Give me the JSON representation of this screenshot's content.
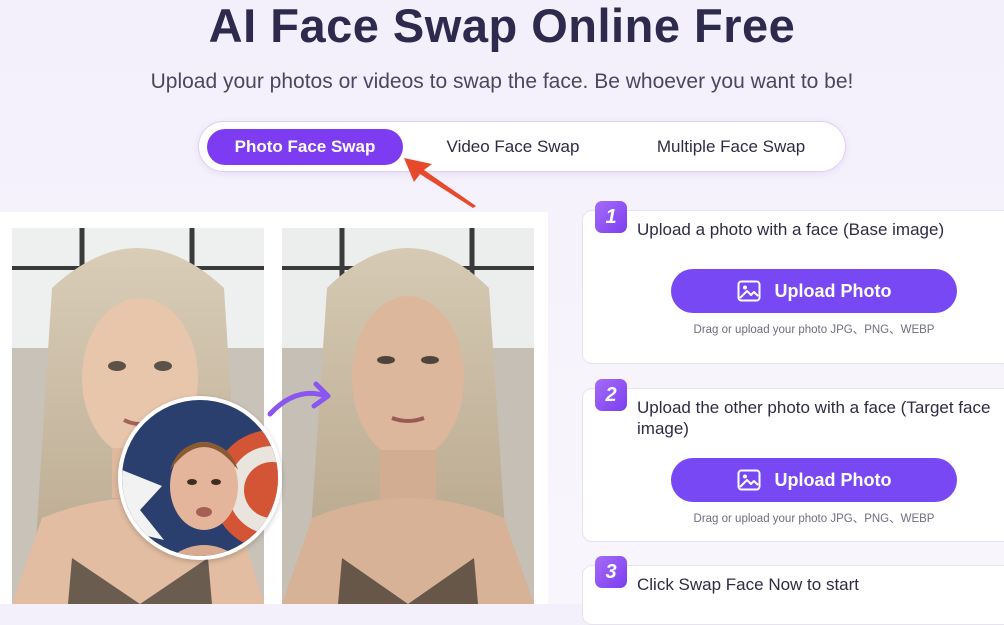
{
  "hero": {
    "title": "AI Face Swap Online Free",
    "subtitle": "Upload your photos or videos to swap the face. Be whoever you want to be!"
  },
  "tabs": [
    {
      "label": "Photo Face Swap",
      "active": true
    },
    {
      "label": "Video Face Swap",
      "active": false
    },
    {
      "label": "Multiple Face Swap",
      "active": false
    }
  ],
  "steps": [
    {
      "number": "1",
      "text": "Upload a photo with a face (Base image)",
      "button": "Upload Photo",
      "hint": "Drag or upload your photo JPG、PNG、WEBP"
    },
    {
      "number": "2",
      "text": "Upload the other photo with a face (Target face image)",
      "button": "Upload Photo",
      "hint": "Drag or upload your photo JPG、PNG、WEBP"
    },
    {
      "number": "3",
      "text": "Click Swap Face Now to start"
    }
  ],
  "colors": {
    "accent": "#7d3cf2",
    "button": "#7748f3",
    "pointer_arrow": "#e8492c",
    "title": "#2d2a4e"
  },
  "icons": {
    "upload": "image-icon",
    "swap": "curved-arrow-icon",
    "pointer": "red-pointer-arrow-icon"
  }
}
